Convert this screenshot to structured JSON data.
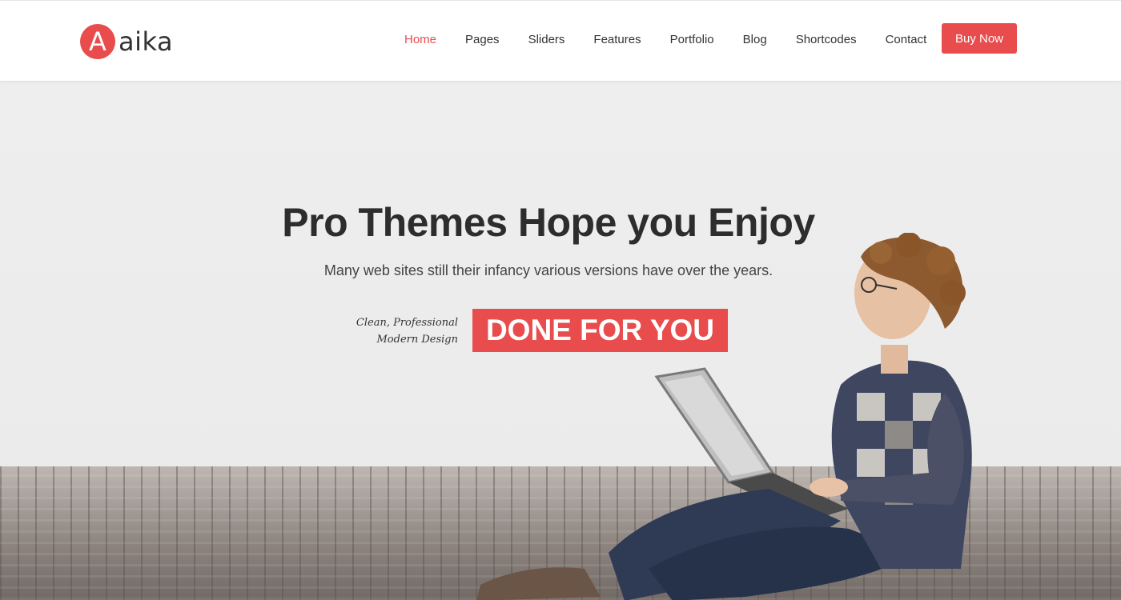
{
  "brand": {
    "logo_letter": "A",
    "logo_text": "aika",
    "accent_color": "#e84c4c"
  },
  "nav": {
    "items": [
      {
        "label": "Home",
        "active": true
      },
      {
        "label": "Pages",
        "active": false
      },
      {
        "label": "Sliders",
        "active": false
      },
      {
        "label": "Features",
        "active": false
      },
      {
        "label": "Portfolio",
        "active": false
      },
      {
        "label": "Blog",
        "active": false
      },
      {
        "label": "Shortcodes",
        "active": false
      },
      {
        "label": "Contact",
        "active": false
      }
    ],
    "buy_label": "Buy Now"
  },
  "hero": {
    "title": "Pro Themes Hope you Enjoy",
    "subtitle": "Many web sites still their infancy various versions have over the years.",
    "tagline_line1": "Clean, Professional",
    "tagline_line2": "Modern Design",
    "highlight": "DONE FOR YOU",
    "image_subject": "person-with-laptop-illustration"
  }
}
